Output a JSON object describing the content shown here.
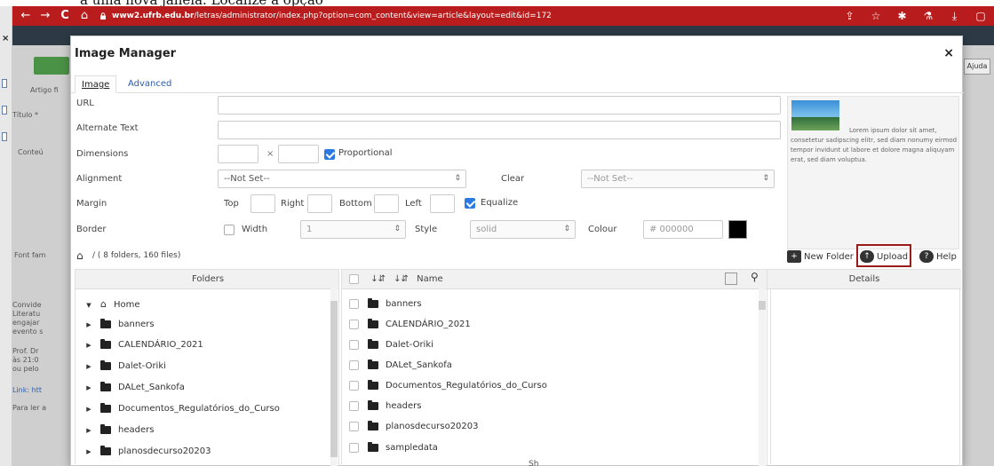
{
  "caption": {
    "text": "a uma nova janela. Localize a opção"
  },
  "browser": {
    "url_domain": "www2.ufrb.edu.br",
    "url_path": "/letras/administrator/index.php?option=com_content&view=article&layout=edit&id=172",
    "back_icon": "←",
    "forward_icon": "→",
    "reload_icon": "C",
    "home_icon": "⌂",
    "toolbar_icons": [
      "share-icon",
      "star-icon",
      "extensions-icon",
      "lab-icon",
      "download-icon",
      "window-icon"
    ]
  },
  "left_panel": {
    "close_label": "×"
  },
  "background_app": {
    "items": [
      "Artigo fi",
      "Título *",
      "Conteú",
      "Font fam",
      "Convide",
      "Literatu",
      "engajar",
      "evento s",
      "Prof. Dr",
      "às 21:0",
      "ou pelo",
      "Link: htt",
      "Para ler a"
    ],
    "ajuda_label": "Ajuda"
  },
  "modal": {
    "title": "Image Manager",
    "close_label": "×",
    "tabs": [
      {
        "label": "Image"
      },
      {
        "label": "Advanced"
      }
    ],
    "fields": {
      "url_label": "URL",
      "alt_label": "Alternate Text",
      "dimensions_label": "Dimensions",
      "dimensions_sep": "×",
      "proportional_label": "Proportional",
      "alignment_label": "Alignment",
      "alignment_value": "--Not Set--",
      "clear_label": "Clear",
      "clear_value": "--Not Set--",
      "margin_label": "Margin",
      "margin_top": "Top",
      "margin_right": "Right",
      "margin_bottom": "Bottom",
      "margin_left": "Left",
      "equalize_label": "Equalize",
      "border_label": "Border",
      "width_label": "Width",
      "width_value": "1",
      "style_label": "Style",
      "style_value": "solid",
      "colour_label": "Colour",
      "colour_placeholder": "# 000000",
      "colour_value": "#000000"
    },
    "preview_text": "Lorem ipsum dolor sit amet, consetetur sadipscing elitr, sed diam nonumy eirmod tempor invidunt ut labore et dolore magna aliquyam erat, sed diam voluptua.",
    "path": {
      "text": "/ ( 8 folders, 160 files)"
    },
    "actions": {
      "new_folder": "New Folder",
      "upload": "Upload",
      "help": "Help"
    },
    "columns": {
      "folders": "Folders",
      "name": "Name",
      "details": "Details"
    },
    "folders": [
      {
        "label": "Home",
        "root": true
      },
      {
        "label": "banners"
      },
      {
        "label": "CALENDÁRIO_2021"
      },
      {
        "label": "Dalet-Oriki"
      },
      {
        "label": "DALet_Sankofa"
      },
      {
        "label": "Documentos_Regulatórios_do_Curso"
      },
      {
        "label": "headers"
      },
      {
        "label": "planosdecurso20203"
      }
    ],
    "files": [
      "banners",
      "CALENDÁRIO_2021",
      "Dalet-Oriki",
      "DALet_Sankofa",
      "Documentos_Regulatórios_do_Curso",
      "headers",
      "planosdecurso20203",
      "sampledata"
    ],
    "footer_partial": "Sh"
  }
}
